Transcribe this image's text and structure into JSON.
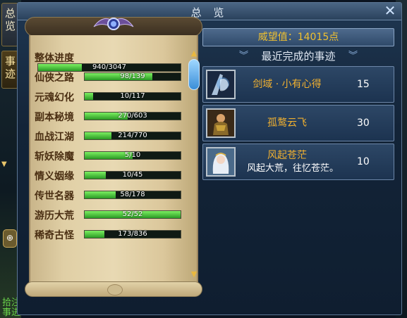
{
  "side_tabs": [
    {
      "label": "总览"
    },
    {
      "label": "事迹"
    }
  ],
  "left_edge": {
    "bottom_text": "拾注\n事进"
  },
  "window": {
    "title": "总 览"
  },
  "progress": [
    {
      "label": "整体进度",
      "text": "940/3047",
      "fraction": 0.309
    },
    {
      "label": "仙侠之路",
      "text": "98/139",
      "fraction": 0.705
    },
    {
      "label": "元魂幻化",
      "text": "10/117",
      "fraction": 0.085
    },
    {
      "label": "副本秘境",
      "text": "270/603",
      "fraction": 0.448
    },
    {
      "label": "血战江湖",
      "text": "214/770",
      "fraction": 0.278
    },
    {
      "label": "斩妖除魔",
      "text": "5/10",
      "fraction": 0.5
    },
    {
      "label": "情义姻缘",
      "text": "10/45",
      "fraction": 0.222
    },
    {
      "label": "传世名器",
      "text": "58/178",
      "fraction": 0.326
    },
    {
      "label": "游历大荒",
      "text": "52/52",
      "fraction": 1.0
    },
    {
      "label": "稀奇古怪",
      "text": "173/836",
      "fraction": 0.207
    }
  ],
  "prestige": {
    "text": "威望值：14015点"
  },
  "recent": {
    "title": "最近完成的事迹"
  },
  "events": [
    {
      "name": "剑域 · 小有心得",
      "desc": "",
      "points": "15",
      "icon": "sword-domain-icon"
    },
    {
      "name": "孤鹜云飞",
      "desc": "",
      "points": "30",
      "icon": "warrior-portrait-icon"
    },
    {
      "name": "风起苍茫",
      "desc": "风起大荒，往忆苍茫。",
      "points": "10",
      "icon": "maiden-portrait-icon"
    }
  ],
  "colors": {
    "accent": "#f0b030",
    "bar_fill": "#3fbf32",
    "paper": "#e0cfa5"
  }
}
